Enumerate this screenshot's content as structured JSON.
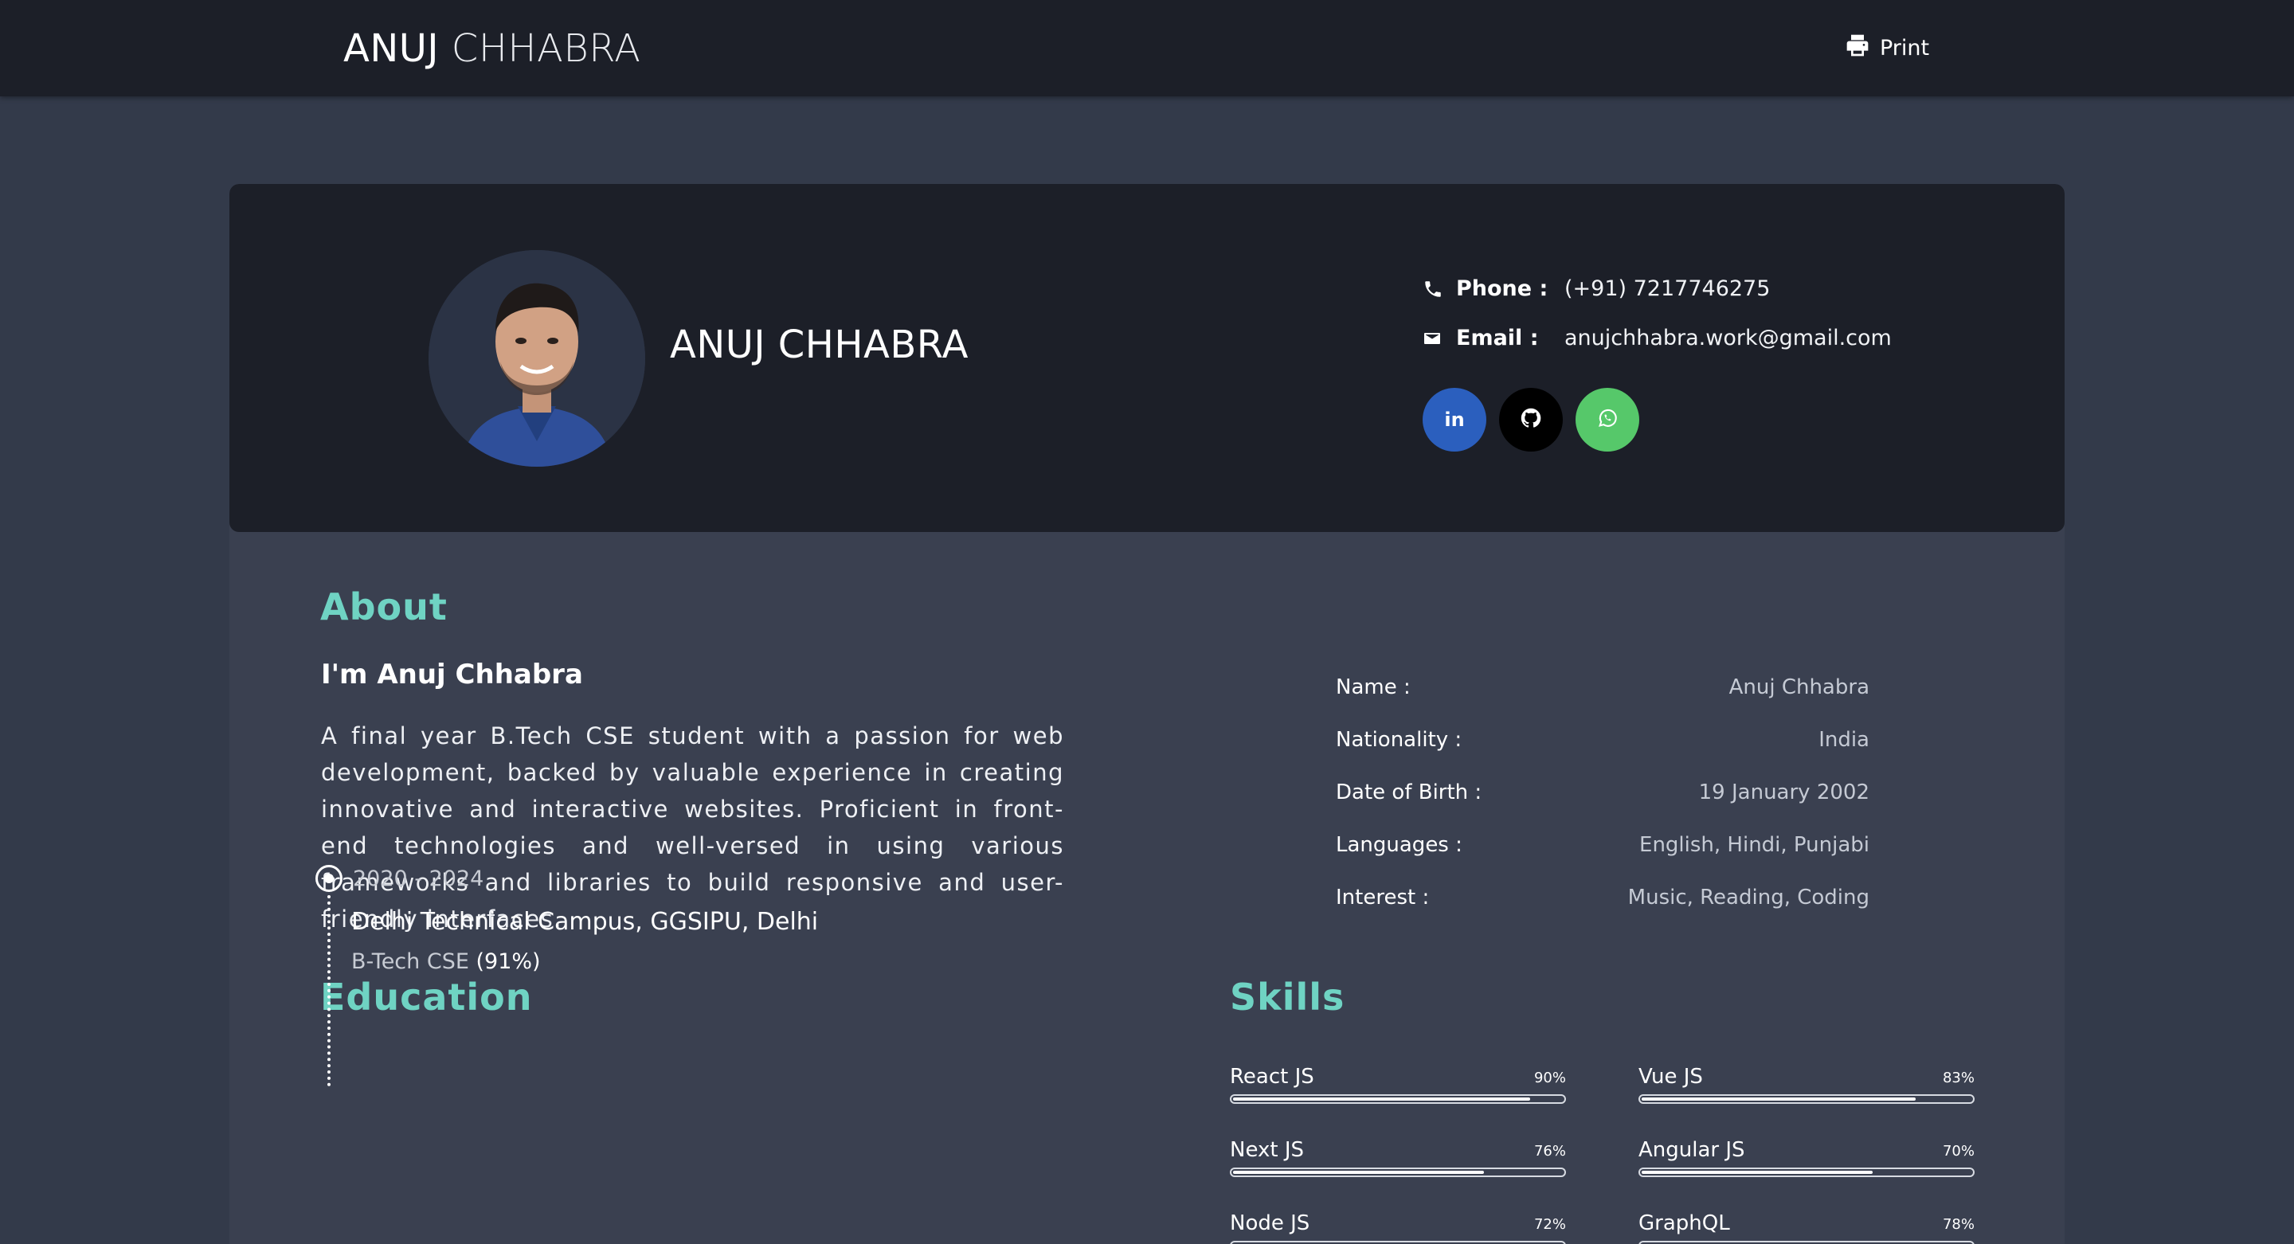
{
  "header": {
    "brand_first": "ANUJ",
    "brand_last": "CHHABRA",
    "print_label": "Print"
  },
  "profile": {
    "name": "ANUJ CHHABRA",
    "avatar_icon": "profile-photo",
    "phone_label": "Phone :",
    "phone": "(+91) 7217746275",
    "email_label": "Email :",
    "email": "anujchhabra.work@gmail.com",
    "socials": [
      {
        "icon": "linkedin-icon",
        "label": "in",
        "color": "#2b5fbe"
      },
      {
        "icon": "github-icon",
        "color": "#000000"
      },
      {
        "icon": "whatsapp-icon",
        "color": "#56c86a"
      }
    ]
  },
  "about": {
    "title": "About",
    "subtitle": "I'm Anuj Chhabra",
    "text": "A final year B.Tech CSE student with a passion for web development, backed by valuable experience in creating innovative and interactive websites. Proficient in front-end technologies and well-versed in using various frameworks and libraries to build responsive and user-friendly interfaces.",
    "details": [
      {
        "key": "Name :",
        "value": "Anuj Chhabra"
      },
      {
        "key": "Nationality :",
        "value": "India"
      },
      {
        "key": "Date of Birth :",
        "value": "19 January 2002"
      },
      {
        "key": "Languages :",
        "value": "English, Hindi, Punjabi"
      },
      {
        "key": "Interest :",
        "value": "Music, Reading, Coding"
      }
    ]
  },
  "education": {
    "title": "Education",
    "items": [
      {
        "years": "2020 - 2024",
        "school": "Delhi Technical Campus, GGSIPU, Delhi",
        "degree": "B-Tech CSE",
        "score": "(91%)"
      }
    ]
  },
  "skills": {
    "title": "Skills",
    "items": [
      {
        "name": "React JS",
        "percent_label": "90%",
        "level": 0.9
      },
      {
        "name": "Vue JS",
        "percent_label": "83%",
        "level": 0.83
      },
      {
        "name": "Next JS",
        "percent_label": "76%",
        "level": 0.76
      },
      {
        "name": "Angular JS",
        "percent_label": "70%",
        "level": 0.7
      },
      {
        "name": "Node JS",
        "percent_label": "72%",
        "level": 0.72
      },
      {
        "name": "GraphQL",
        "percent_label": "78%",
        "level": 0.78
      }
    ]
  },
  "colors": {
    "accent": "#6fd3c3",
    "header_bg": "#1c1f28",
    "page_bg": "#333a4a",
    "card_bg": "#3a4050"
  }
}
